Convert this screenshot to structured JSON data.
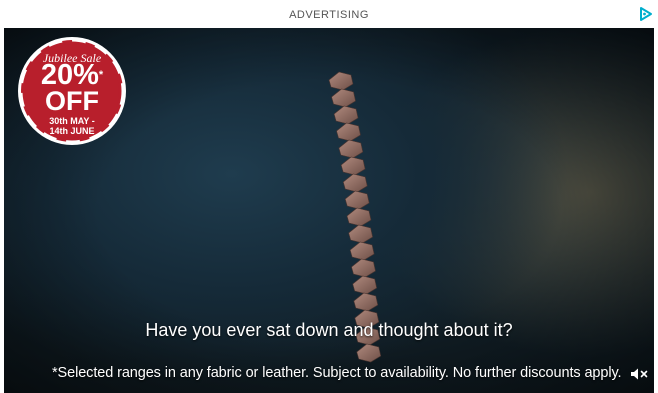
{
  "header": {
    "label": "ADVERTISING",
    "adchoices_icon": "adchoices-icon"
  },
  "badge": {
    "script_text": "Jubilee Sale",
    "discount_big": "20%",
    "discount_word": "OFF",
    "discount_mark": "*",
    "date_line1": "30th MAY -",
    "date_line2": "14th JUNE",
    "color": "#b81f2c"
  },
  "video": {
    "caption": "Have you ever sat down and thought about it?",
    "disclaimer": "*Selected ranges in any fabric or leather. Subject to availability. No further discounts apply.",
    "mute_icon": "speaker-muted-icon"
  },
  "colors": {
    "adchoices": "#00aecd",
    "caption_text": "#ffffff"
  }
}
